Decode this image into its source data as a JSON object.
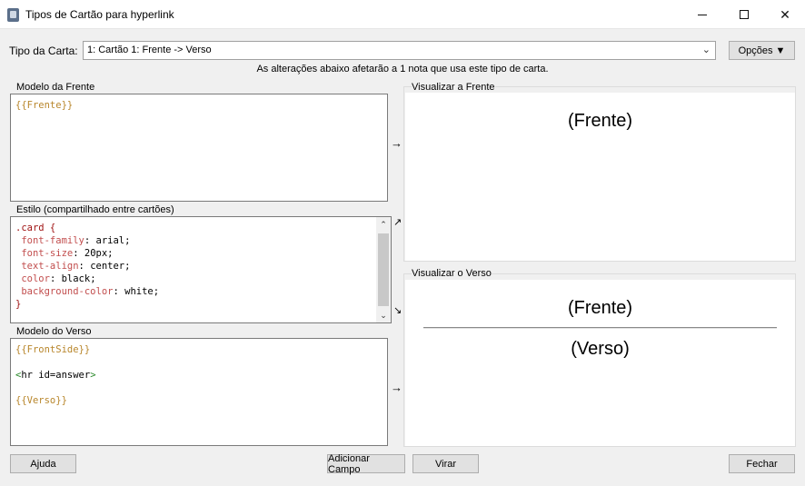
{
  "window": {
    "title": "Tipos de Cartão para hyperlink",
    "icon": "anki-app-icon"
  },
  "top": {
    "card_type_label": "Tipo da Carta:",
    "card_type_value": "1: Cartão 1: Frente -> Verso",
    "options_label": "Opções ▼",
    "notice": "As alterações abaixo afetarão a 1 nota que usa este tipo de carta."
  },
  "front_template": {
    "label": "Modelo da Frente",
    "line1": "{{Frente}}"
  },
  "style": {
    "label": "Estilo (compartilhado entre cartões)",
    "selector": ".card",
    "open_brace": " {",
    "lines": [
      {
        "prop": "font-family",
        "value": ": arial;"
      },
      {
        "prop": "font-size",
        "value": ": 20px;"
      },
      {
        "prop": "text-align",
        "value": ": center;"
      },
      {
        "prop": "color",
        "value": ": black;"
      },
      {
        "prop": "background-color",
        "value": ": white;"
      }
    ],
    "close_brace": "}"
  },
  "back_template": {
    "label": "Modelo do Verso",
    "line1": "{{FrontSide}}",
    "hr_open": "<",
    "hr_tag": "hr id=answer",
    "hr_close": ">",
    "line3": "{{Verso}}"
  },
  "preview_front": {
    "label": "Visualizar a Frente",
    "text": "(Frente)"
  },
  "preview_back": {
    "label": "Visualizar o Verso",
    "front_text": "(Frente)",
    "back_text": "(Verso)"
  },
  "arrows": {
    "front": "→",
    "style_up": "↗",
    "style_down": "↘",
    "back": "→"
  },
  "buttons": {
    "help": "Ajuda",
    "add_field": "Adicionar Campo",
    "flip": "Virar",
    "close": "Fechar"
  }
}
